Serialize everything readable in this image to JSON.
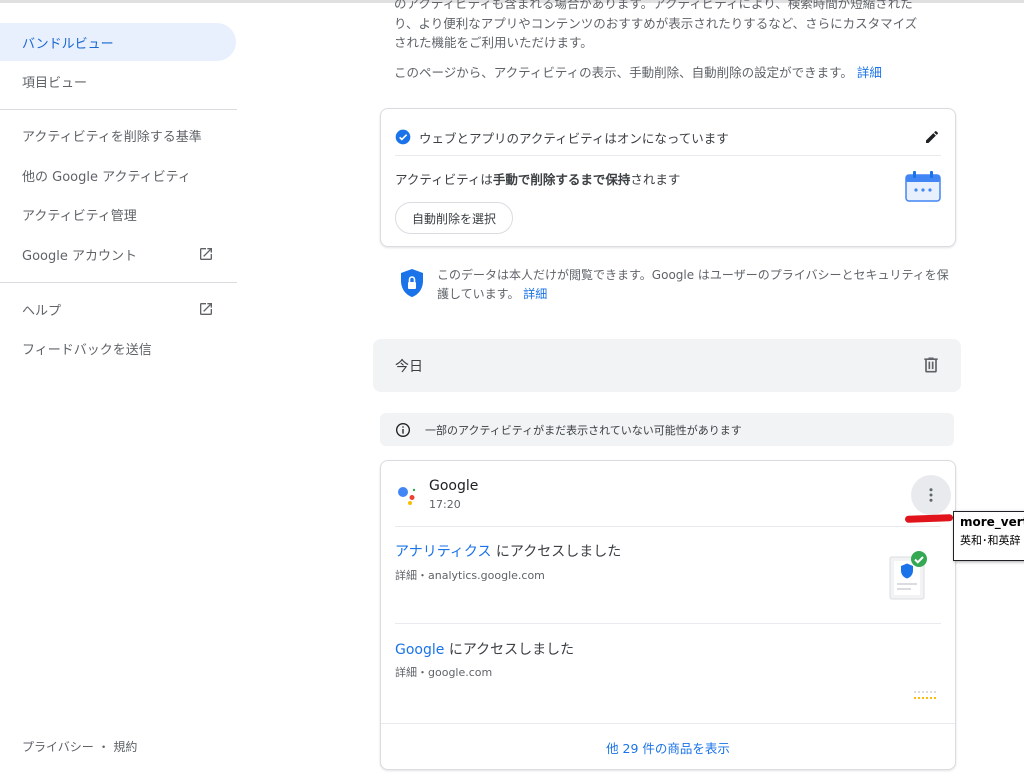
{
  "sidebar": {
    "items": [
      {
        "label": "バンドルビュー",
        "active": true
      },
      {
        "label": "項目ビュー"
      },
      {
        "label": "アクティビティを削除する基準"
      },
      {
        "label": "他の Google アクティビティ"
      },
      {
        "label": "アクティビティ管理"
      },
      {
        "label": "Google アカウント",
        "icon": "open-in-new-icon"
      },
      {
        "label": "ヘルプ",
        "icon": "open-in-new-icon"
      },
      {
        "label": "フィードバックを送信"
      }
    ],
    "footer": "プライバシー ・ 規約"
  },
  "intro": {
    "line1": "のアクティビティも含まれる場合があります。アクティビティにより、検索時間が短縮された",
    "line2": "り、より便利なアプリやコンテンツのおすすめが表示されたりするなど、さらにカスタマイズ",
    "line3": "された機能をご利用いただけます。",
    "line4": "このページから、アクティビティの表示、手動削除、自動削除の設定ができます。",
    "link": "詳細"
  },
  "settings_card": {
    "status": "ウェブとアプリのアクティビティはオンになっています",
    "keep_prefix": "アクティビティは",
    "keep_bold": "手動で削除するまで保持",
    "keep_suffix": "されます",
    "auto_delete_button": "自動削除を選択"
  },
  "privacy_note": {
    "text": "このデータは本人だけが閲覧できます。Google はユーザーのプライバシーとセキュリティを保護しています。",
    "link": "詳細"
  },
  "today": {
    "label": "今日"
  },
  "notice": {
    "text": "一部のアクティビティがまだ表示されていない可能性があります"
  },
  "activity_card": {
    "title": "Google",
    "time": "17:20",
    "items": [
      {
        "link": "アナリティクス",
        "text": " にアクセスしました",
        "sub": "詳細・analytics.google.com"
      },
      {
        "link": "Google",
        "text": " にアクセスしました",
        "sub": "詳細・google.com"
      }
    ],
    "show_more": "他 29 件の商品を表示"
  },
  "tooltip": {
    "title": "more_vert",
    "subtitle": "英和･和英辞"
  },
  "colors": {
    "accent": "#1a73e8",
    "active_bg": "#e8f0fe",
    "annotation": "#e0141a"
  }
}
